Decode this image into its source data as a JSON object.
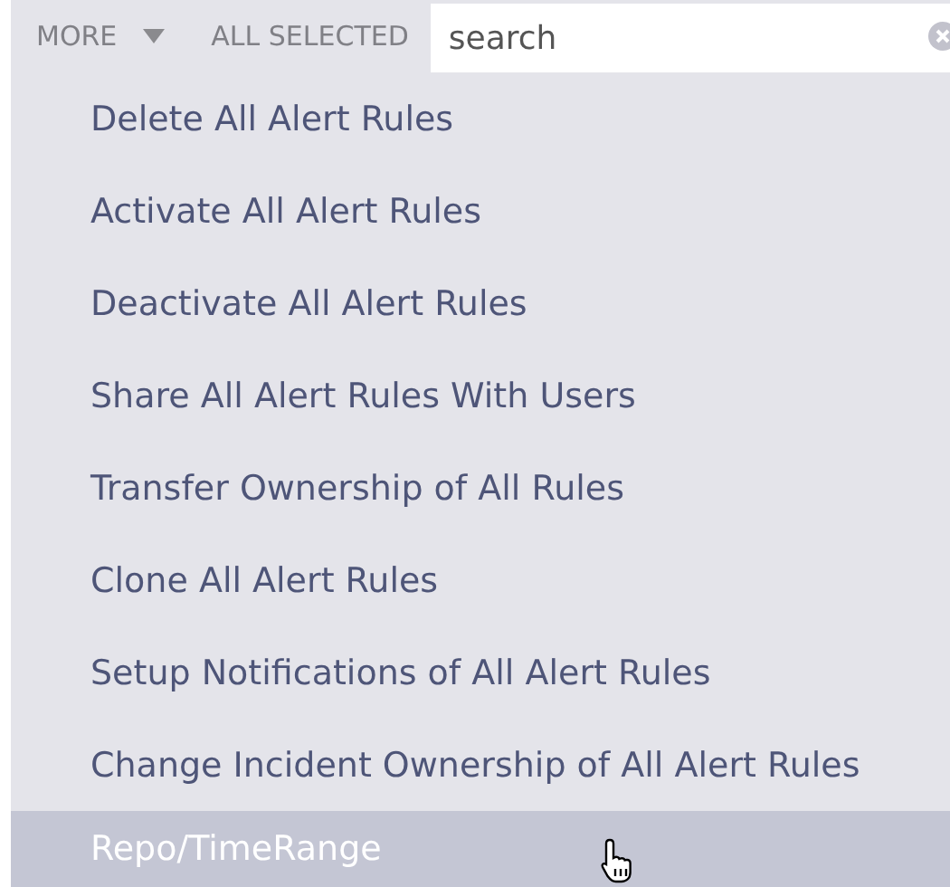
{
  "toolbar": {
    "more": "MORE",
    "all_selected": "ALL SELECTED",
    "search": {
      "placeholder": "search"
    }
  },
  "menu": [
    {
      "label": "Delete All Alert Rules",
      "selected": false
    },
    {
      "label": "Activate All Alert Rules",
      "selected": false
    },
    {
      "label": "Deactivate All Alert Rules",
      "selected": false
    },
    {
      "label": "Share All Alert Rules With Users",
      "selected": false
    },
    {
      "label": "Transfer Ownership of All Rules",
      "selected": false
    },
    {
      "label": "Clone All Alert Rules",
      "selected": false
    },
    {
      "label": "Setup Notifications of All Alert Rules",
      "selected": false
    },
    {
      "label": "Change Incident Ownership of All Alert Rules",
      "selected": false
    },
    {
      "label": "Repo/TimeRange",
      "selected": true
    }
  ]
}
